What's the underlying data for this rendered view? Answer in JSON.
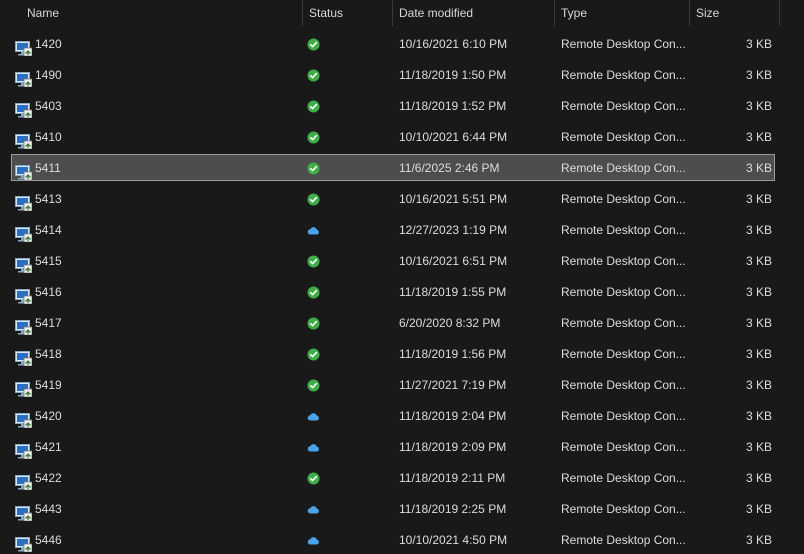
{
  "columns": {
    "name": "Name",
    "status": "Status",
    "date": "Date modified",
    "type": "Type",
    "size": "Size"
  },
  "colors": {
    "synced_green": "#3fae49",
    "cloud_blue": "#4aa3e8",
    "selection_bg": "#4d4d4d",
    "selection_border": "#9a9a9a"
  },
  "files": [
    {
      "name": "1420",
      "status": "synced",
      "date": "10/16/2021 6:10 PM",
      "type": "Remote Desktop Con...",
      "size": "3 KB"
    },
    {
      "name": "1490",
      "status": "synced",
      "date": "11/18/2019 1:50 PM",
      "type": "Remote Desktop Con...",
      "size": "3 KB"
    },
    {
      "name": "5403",
      "status": "synced",
      "date": "11/18/2019 1:52 PM",
      "type": "Remote Desktop Con...",
      "size": "3 KB"
    },
    {
      "name": "5410",
      "status": "synced",
      "date": "10/10/2021 6:44 PM",
      "type": "Remote Desktop Con...",
      "size": "3 KB"
    },
    {
      "name": "5411",
      "status": "synced",
      "date": "11/6/2025 2:46 PM",
      "type": "Remote Desktop Con...",
      "size": "3 KB",
      "selected": true
    },
    {
      "name": "5413",
      "status": "synced",
      "date": "10/16/2021 5:51 PM",
      "type": "Remote Desktop Con...",
      "size": "3 KB"
    },
    {
      "name": "5414",
      "status": "cloud",
      "date": "12/27/2023 1:19 PM",
      "type": "Remote Desktop Con...",
      "size": "3 KB"
    },
    {
      "name": "5415",
      "status": "synced",
      "date": "10/16/2021 6:51 PM",
      "type": "Remote Desktop Con...",
      "size": "3 KB"
    },
    {
      "name": "5416",
      "status": "synced",
      "date": "11/18/2019 1:55 PM",
      "type": "Remote Desktop Con...",
      "size": "3 KB"
    },
    {
      "name": "5417",
      "status": "synced",
      "date": "6/20/2020 8:32 PM",
      "type": "Remote Desktop Con...",
      "size": "3 KB"
    },
    {
      "name": "5418",
      "status": "synced",
      "date": "11/18/2019 1:56 PM",
      "type": "Remote Desktop Con...",
      "size": "3 KB"
    },
    {
      "name": "5419",
      "status": "synced",
      "date": "11/27/2021 7:19 PM",
      "type": "Remote Desktop Con...",
      "size": "3 KB"
    },
    {
      "name": "5420",
      "status": "cloud",
      "date": "11/18/2019 2:04 PM",
      "type": "Remote Desktop Con...",
      "size": "3 KB"
    },
    {
      "name": "5421",
      "status": "cloud",
      "date": "11/18/2019 2:09 PM",
      "type": "Remote Desktop Con...",
      "size": "3 KB"
    },
    {
      "name": "5422",
      "status": "synced",
      "date": "11/18/2019 2:11 PM",
      "type": "Remote Desktop Con...",
      "size": "3 KB"
    },
    {
      "name": "5443",
      "status": "cloud",
      "date": "11/18/2019 2:25 PM",
      "type": "Remote Desktop Con...",
      "size": "3 KB"
    },
    {
      "name": "5446",
      "status": "cloud",
      "date": "10/10/2021 4:50 PM",
      "type": "Remote Desktop Con...",
      "size": "3 KB"
    }
  ]
}
